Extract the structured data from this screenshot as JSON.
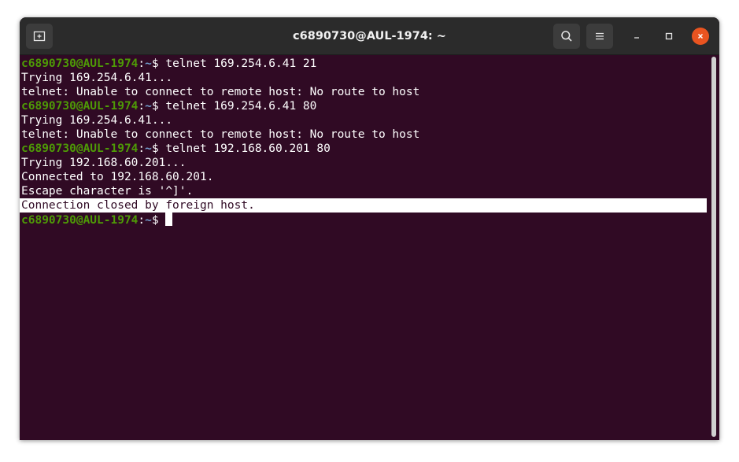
{
  "window": {
    "title": "c6890730@AUL-1974: ~"
  },
  "prompt": {
    "user_host": "c6890730@AUL-1974",
    "sep": ":",
    "path": "~",
    "symbol": "$"
  },
  "lines": [
    {
      "type": "prompt",
      "command": " telnet 169.254.6.41 21"
    },
    {
      "type": "output",
      "text": "Trying 169.254.6.41..."
    },
    {
      "type": "output",
      "text": "telnet: Unable to connect to remote host: No route to host"
    },
    {
      "type": "prompt",
      "command": " telnet 169.254.6.41 80"
    },
    {
      "type": "output",
      "text": "Trying 169.254.6.41..."
    },
    {
      "type": "output",
      "text": "telnet: Unable to connect to remote host: No route to host"
    },
    {
      "type": "prompt",
      "command": " telnet 192.168.60.201 80"
    },
    {
      "type": "output",
      "text": "Trying 192.168.60.201..."
    },
    {
      "type": "output",
      "text": "Connected to 192.168.60.201."
    },
    {
      "type": "output",
      "text": "Escape character is '^]'."
    },
    {
      "type": "output",
      "text": "Connection closed by foreign host.",
      "selected": true
    },
    {
      "type": "prompt",
      "command": " ",
      "cursor": true
    }
  ],
  "colors": {
    "terminal_bg": "#300a24",
    "prompt_user": "#4e9a06",
    "prompt_path": "#729fcf",
    "close_button": "#e95420"
  },
  "icons": {
    "new_tab": "new-tab-icon",
    "search": "search-icon",
    "menu": "hamburger-menu-icon",
    "minimize": "minimize-icon",
    "maximize": "maximize-icon",
    "close": "close-icon"
  }
}
